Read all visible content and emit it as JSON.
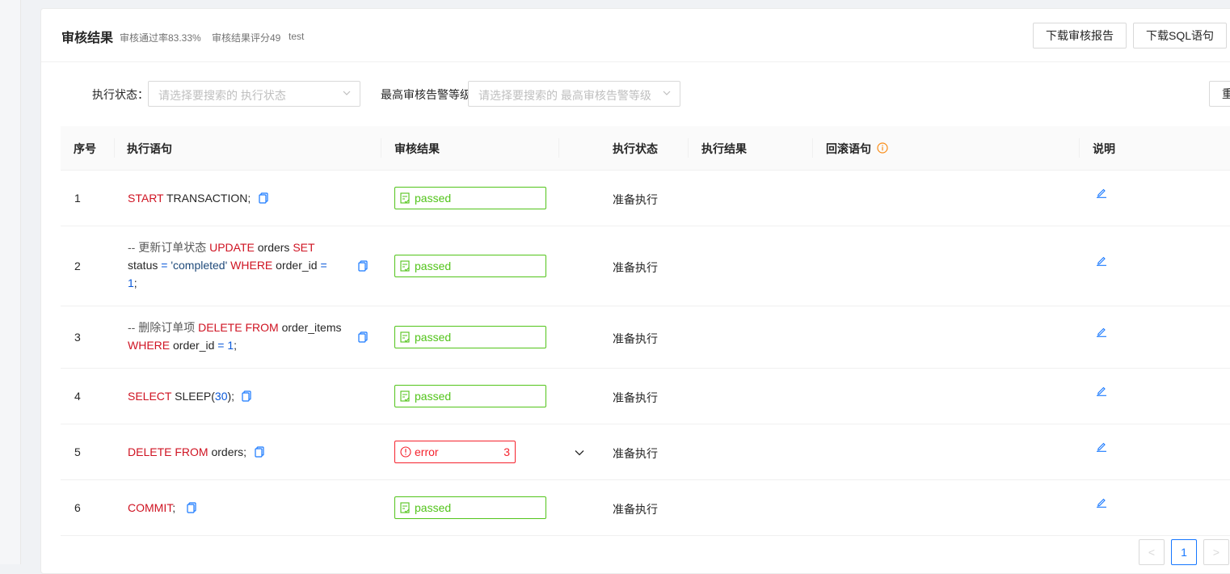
{
  "header": {
    "title": "审核结果",
    "pass_rate": "审核通过率83.33%",
    "score": "审核结果评分49",
    "instance": "test",
    "download_report": "下载审核报告",
    "download_sql": "下载SQL语句"
  },
  "filters": {
    "exec_status_label": "执行状态：",
    "exec_status_placeholder": "请选择要搜索的 执行状态",
    "level_label": "最高审核告警等级",
    "level_placeholder": "请选择要搜索的 最高审核告警等级",
    "reset_label": "重"
  },
  "table": {
    "columns": {
      "index": "序号",
      "sql": "执行语句",
      "audit": "审核结果",
      "exec_status": "执行状态",
      "exec_result": "执行结果",
      "rollback": "回滚语句",
      "desc": "说明"
    },
    "rows": [
      {
        "index": "1",
        "audit": "passed",
        "status": "准备执行"
      },
      {
        "index": "2",
        "audit": "passed",
        "status": "准备执行"
      },
      {
        "index": "3",
        "audit": "passed",
        "status": "准备执行"
      },
      {
        "index": "4",
        "audit": "passed",
        "status": "准备执行"
      },
      {
        "index": "5",
        "audit": "error",
        "error_count": "3",
        "status": "准备执行"
      },
      {
        "index": "6",
        "audit": "passed",
        "status": "准备执行"
      }
    ],
    "sql": {
      "r1": {
        "kw1": "START",
        "t1": " TRANSACTION;"
      },
      "r2": {
        "c1": "-- 更新订单状态 ",
        "kw1": "UPDATE",
        "t1": " orders ",
        "kw2": "SET",
        "t2": "status ",
        "op1": "=",
        "s1": " 'completed' ",
        "kw3": "WHERE",
        "t3": " order_id ",
        "op2": "=",
        "n1": "1",
        "t4": ";"
      },
      "r3": {
        "c1": "-- 删除订单项 ",
        "kw1": "DELETE FROM",
        "t1": " order_items",
        "kw2": "WHERE",
        "t2": " order_id ",
        "op1": "=",
        "n1": " 1",
        "t3": ";"
      },
      "r4": {
        "kw1": "SELECT",
        "t1": " SLEEP(",
        "n1": "30",
        "t2": ");"
      },
      "r5": {
        "kw1": "DELETE FROM",
        "t1": " orders;"
      },
      "r6": {
        "kw1": "COMMIT",
        "t1": ";"
      }
    }
  },
  "pagination": {
    "prev": "<",
    "current": "1",
    "next": ">"
  },
  "colors": {
    "passed": "#52c41a",
    "error": "#f5222d",
    "keyword": "#cf1322",
    "link": "#1677ff"
  }
}
